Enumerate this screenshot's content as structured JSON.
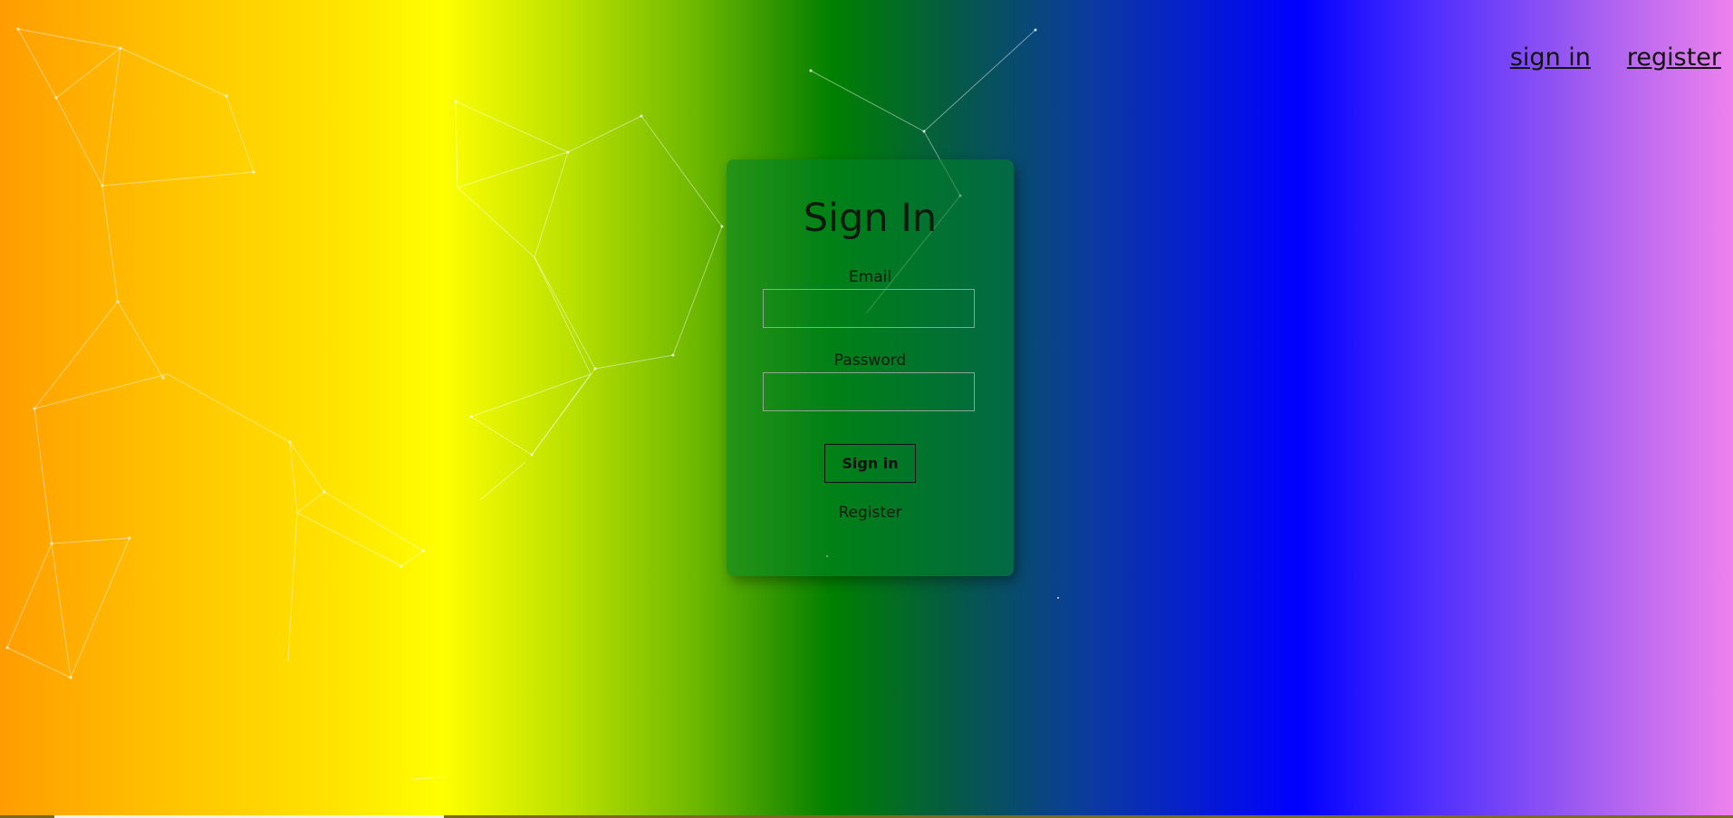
{
  "nav": {
    "sign_in_label": "sign in",
    "register_label": "register"
  },
  "form": {
    "title": "Sign In",
    "email_label": "Email",
    "email_value": "",
    "password_label": "Password",
    "password_value": "",
    "submit_label": "Sign in",
    "register_link_label": "Register"
  }
}
